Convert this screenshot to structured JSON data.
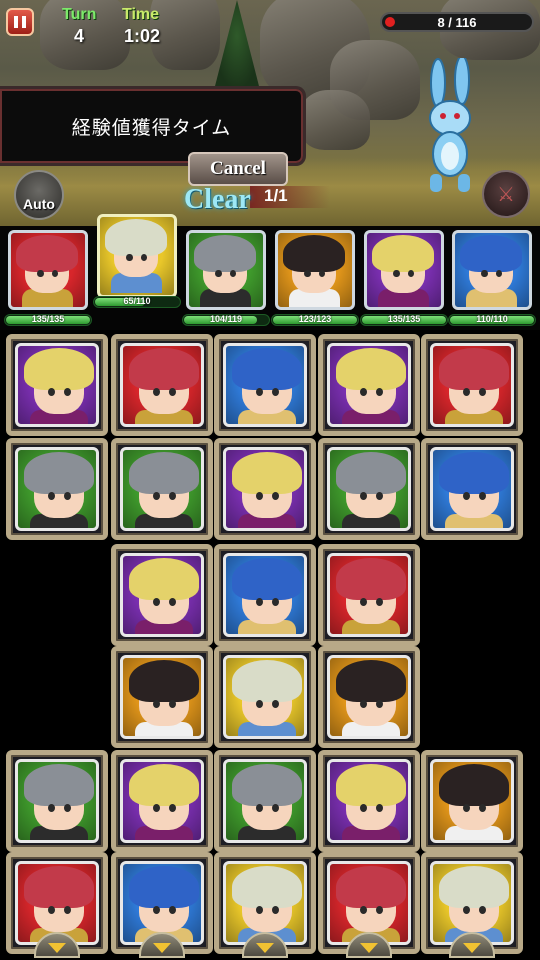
{
  "hud": {
    "turn_label": "Turn",
    "turn_value": "4",
    "time_label": "Time",
    "time_value": "1:02",
    "enemy_hp_text": "8 / 116",
    "enemy_hp_fraction": 0.07,
    "exp_banner": "経験値獲得タイム",
    "cancel_label": "Cancel",
    "clear_label": "Clear",
    "clear_count": "1/1",
    "auto_label": "Auto"
  },
  "colors": {
    "red": "#d8262b",
    "yellow": "#e9c72a",
    "green": "#3f9a2c",
    "orange": "#e0951a",
    "purple": "#7a2fb0",
    "blue": "#2f7ad8"
  },
  "party": [
    {
      "name": "red-hero",
      "color": "red",
      "hp": "135",
      "max": "135",
      "hp_fraction": 1.0
    },
    {
      "name": "yellow-hero",
      "color": "yellow",
      "hp": "65",
      "max": "110",
      "hp_fraction": 0.59
    },
    {
      "name": "green-hero",
      "color": "green",
      "hp": "104",
      "max": "119",
      "hp_fraction": 0.87
    },
    {
      "name": "orange-hero",
      "color": "orange",
      "hp": "123",
      "max": "123",
      "hp_fraction": 1.0
    },
    {
      "name": "purple-hero",
      "color": "purple",
      "hp": "135",
      "max": "135",
      "hp_fraction": 1.0
    },
    {
      "name": "blue-hero",
      "color": "blue",
      "hp": "110",
      "max": "110",
      "hp_fraction": 1.0
    }
  ],
  "board": [
    [
      "purple",
      "red",
      "blue",
      "purple",
      "red"
    ],
    [
      "green",
      "green",
      "purple",
      "green",
      "blue"
    ],
    [
      null,
      "purple",
      "blue",
      "red",
      null
    ],
    [
      null,
      "orange",
      "yellow",
      "orange",
      null
    ],
    [
      "green",
      "purple",
      "green",
      "purple",
      "orange"
    ],
    [
      "red",
      "blue",
      "yellow",
      "red",
      "yellow"
    ]
  ]
}
